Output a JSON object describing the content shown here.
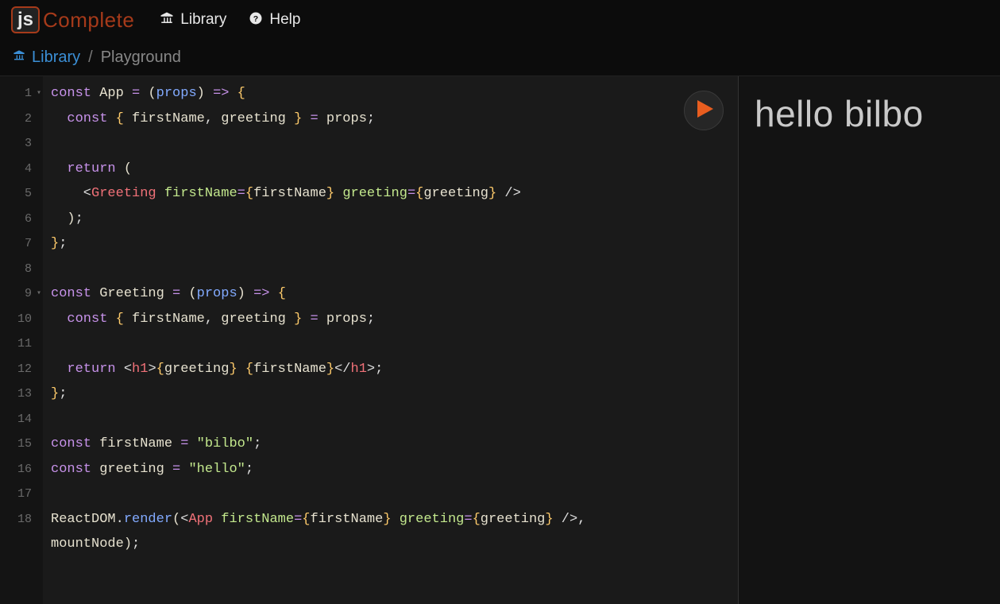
{
  "brand": {
    "box": "js",
    "text": "Complete"
  },
  "nav": {
    "library": "Library",
    "help": "Help"
  },
  "breadcrumb": {
    "library": "Library",
    "sep": "/",
    "current": "Playground"
  },
  "editor": {
    "line_numbers": [
      "1",
      "2",
      "3",
      "4",
      "5",
      "6",
      "7",
      "8",
      "9",
      "10",
      "11",
      "12",
      "13",
      "14",
      "15",
      "16",
      "17",
      "18"
    ],
    "fold_lines": [
      1,
      9
    ],
    "code_lines": [
      [
        {
          "t": "const ",
          "c": "tok-kw"
        },
        {
          "t": "App ",
          "c": "tok-id"
        },
        {
          "t": "= ",
          "c": "tok-op"
        },
        {
          "t": "(",
          "c": "tok-paren"
        },
        {
          "t": "props",
          "c": "tok-prop"
        },
        {
          "t": ") ",
          "c": "tok-paren"
        },
        {
          "t": "=> ",
          "c": "tok-op"
        },
        {
          "t": "{",
          "c": "tok-brace"
        }
      ],
      [
        {
          "t": "  const ",
          "c": "tok-kw"
        },
        {
          "t": "{ ",
          "c": "tok-brace"
        },
        {
          "t": "firstName",
          "c": "tok-id"
        },
        {
          "t": ", ",
          "c": "tok-punc"
        },
        {
          "t": "greeting ",
          "c": "tok-id"
        },
        {
          "t": "} ",
          "c": "tok-brace"
        },
        {
          "t": "= ",
          "c": "tok-op"
        },
        {
          "t": "props",
          "c": "tok-id"
        },
        {
          "t": ";",
          "c": "tok-punc"
        }
      ],
      [
        {
          "t": "",
          "c": ""
        }
      ],
      [
        {
          "t": "  return ",
          "c": "tok-kw"
        },
        {
          "t": "(",
          "c": "tok-paren"
        }
      ],
      [
        {
          "t": "    <",
          "c": "tok-punc"
        },
        {
          "t": "Greeting ",
          "c": "tok-tag"
        },
        {
          "t": "firstName",
          "c": "tok-attr"
        },
        {
          "t": "=",
          "c": "tok-op"
        },
        {
          "t": "{",
          "c": "tok-brace"
        },
        {
          "t": "firstName",
          "c": "tok-id"
        },
        {
          "t": "} ",
          "c": "tok-brace"
        },
        {
          "t": "greeting",
          "c": "tok-attr"
        },
        {
          "t": "=",
          "c": "tok-op"
        },
        {
          "t": "{",
          "c": "tok-brace"
        },
        {
          "t": "greeting",
          "c": "tok-id"
        },
        {
          "t": "} ",
          "c": "tok-brace"
        },
        {
          "t": "/>",
          "c": "tok-punc"
        }
      ],
      [
        {
          "t": "  )",
          "c": "tok-paren"
        },
        {
          "t": ";",
          "c": "tok-punc"
        }
      ],
      [
        {
          "t": "}",
          "c": "tok-brace"
        },
        {
          "t": ";",
          "c": "tok-punc"
        }
      ],
      [
        {
          "t": "",
          "c": ""
        }
      ],
      [
        {
          "t": "const ",
          "c": "tok-kw"
        },
        {
          "t": "Greeting ",
          "c": "tok-id"
        },
        {
          "t": "= ",
          "c": "tok-op"
        },
        {
          "t": "(",
          "c": "tok-paren"
        },
        {
          "t": "props",
          "c": "tok-prop"
        },
        {
          "t": ") ",
          "c": "tok-paren"
        },
        {
          "t": "=> ",
          "c": "tok-op"
        },
        {
          "t": "{",
          "c": "tok-brace"
        }
      ],
      [
        {
          "t": "  const ",
          "c": "tok-kw"
        },
        {
          "t": "{ ",
          "c": "tok-brace"
        },
        {
          "t": "firstName",
          "c": "tok-id"
        },
        {
          "t": ", ",
          "c": "tok-punc"
        },
        {
          "t": "greeting ",
          "c": "tok-id"
        },
        {
          "t": "} ",
          "c": "tok-brace"
        },
        {
          "t": "= ",
          "c": "tok-op"
        },
        {
          "t": "props",
          "c": "tok-id"
        },
        {
          "t": ";",
          "c": "tok-punc"
        }
      ],
      [
        {
          "t": "",
          "c": ""
        }
      ],
      [
        {
          "t": "  return ",
          "c": "tok-kw"
        },
        {
          "t": "<",
          "c": "tok-punc"
        },
        {
          "t": "h1",
          "c": "tok-tag"
        },
        {
          "t": ">",
          "c": "tok-punc"
        },
        {
          "t": "{",
          "c": "tok-brace"
        },
        {
          "t": "greeting",
          "c": "tok-id"
        },
        {
          "t": "} ",
          "c": "tok-brace"
        },
        {
          "t": "{",
          "c": "tok-brace"
        },
        {
          "t": "firstName",
          "c": "tok-id"
        },
        {
          "t": "}",
          "c": "tok-brace"
        },
        {
          "t": "</",
          "c": "tok-punc"
        },
        {
          "t": "h1",
          "c": "tok-tag"
        },
        {
          "t": ">",
          "c": "tok-punc"
        },
        {
          "t": ";",
          "c": "tok-punc"
        }
      ],
      [
        {
          "t": "}",
          "c": "tok-brace"
        },
        {
          "t": ";",
          "c": "tok-punc"
        }
      ],
      [
        {
          "t": "",
          "c": ""
        }
      ],
      [
        {
          "t": "const ",
          "c": "tok-kw"
        },
        {
          "t": "firstName ",
          "c": "tok-id"
        },
        {
          "t": "= ",
          "c": "tok-op"
        },
        {
          "t": "\"bilbo\"",
          "c": "tok-str"
        },
        {
          "t": ";",
          "c": "tok-punc"
        }
      ],
      [
        {
          "t": "const ",
          "c": "tok-kw"
        },
        {
          "t": "greeting ",
          "c": "tok-id"
        },
        {
          "t": "= ",
          "c": "tok-op"
        },
        {
          "t": "\"hello\"",
          "c": "tok-str"
        },
        {
          "t": ";",
          "c": "tok-punc"
        }
      ],
      [
        {
          "t": "",
          "c": ""
        }
      ],
      [
        {
          "t": "ReactDOM",
          "c": "tok-id"
        },
        {
          "t": ".",
          "c": "tok-punc"
        },
        {
          "t": "render",
          "c": "tok-prop"
        },
        {
          "t": "(",
          "c": "tok-paren"
        },
        {
          "t": "<",
          "c": "tok-punc"
        },
        {
          "t": "App ",
          "c": "tok-tag"
        },
        {
          "t": "firstName",
          "c": "tok-attr"
        },
        {
          "t": "=",
          "c": "tok-op"
        },
        {
          "t": "{",
          "c": "tok-brace"
        },
        {
          "t": "firstName",
          "c": "tok-id"
        },
        {
          "t": "} ",
          "c": "tok-brace"
        },
        {
          "t": "greeting",
          "c": "tok-attr"
        },
        {
          "t": "=",
          "c": "tok-op"
        },
        {
          "t": "{",
          "c": "tok-brace"
        },
        {
          "t": "greeting",
          "c": "tok-id"
        },
        {
          "t": "} ",
          "c": "tok-brace"
        },
        {
          "t": "/>",
          "c": "tok-punc"
        },
        {
          "t": ", ",
          "c": "tok-punc"
        }
      ],
      [
        {
          "t": "mountNode",
          "c": "tok-id"
        },
        {
          "t": ")",
          "c": "tok-paren"
        },
        {
          "t": ";",
          "c": "tok-punc"
        }
      ]
    ]
  },
  "output": {
    "heading": "hello bilbo"
  }
}
